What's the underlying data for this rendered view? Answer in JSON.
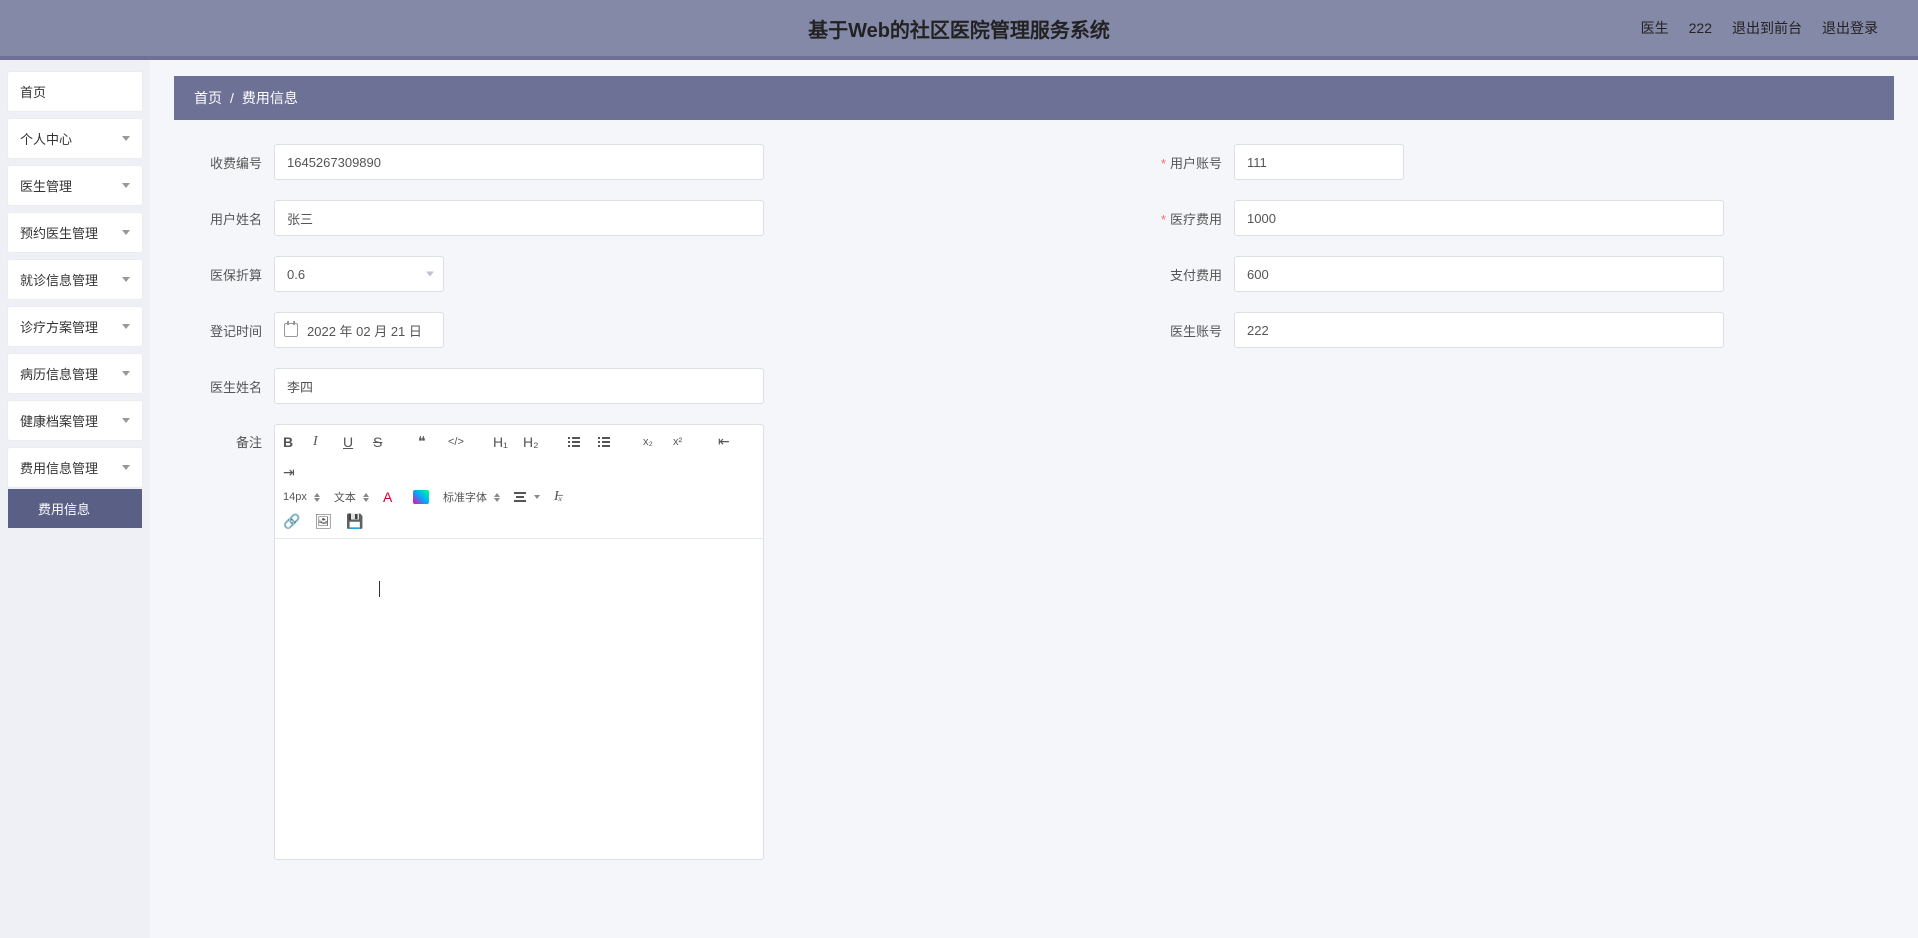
{
  "header": {
    "title": "基于Web的社区医院管理服务系统",
    "user_role_label": "医生",
    "user_name": "222",
    "logout_front": "退出到前台",
    "logout": "退出登录"
  },
  "sidebar": {
    "items": [
      {
        "label": "首页",
        "has_children": false
      },
      {
        "label": "个人中心",
        "has_children": true
      },
      {
        "label": "医生管理",
        "has_children": true
      },
      {
        "label": "预约医生管理",
        "has_children": true
      },
      {
        "label": "就诊信息管理",
        "has_children": true
      },
      {
        "label": "诊疗方案管理",
        "has_children": true
      },
      {
        "label": "病历信息管理",
        "has_children": true
      },
      {
        "label": "健康档案管理",
        "has_children": true
      },
      {
        "label": "费用信息管理",
        "has_children": true,
        "expanded": true,
        "children": [
          {
            "label": "费用信息"
          }
        ]
      }
    ]
  },
  "breadcrumb": {
    "home": "首页",
    "sep": "/",
    "current": "费用信息"
  },
  "form": {
    "fee_no": {
      "label": "收费编号",
      "value": "1645267309890"
    },
    "user_account": {
      "label": "用户账号",
      "value": "111",
      "required": true
    },
    "user_name": {
      "label": "用户姓名",
      "value": "张三"
    },
    "medical_fee": {
      "label": "医疗费用",
      "value": "1000",
      "required": true
    },
    "insurance_ratio": {
      "label": "医保折算",
      "value": "0.6"
    },
    "pay_fee": {
      "label": "支付费用",
      "value": "600"
    },
    "reg_time": {
      "label": "登记时间",
      "value": "2022 年 02 月 21 日"
    },
    "doctor_account": {
      "label": "医生账号",
      "value": "222"
    },
    "doctor_name": {
      "label": "医生姓名",
      "value": "李四"
    },
    "remark": {
      "label": "备注"
    }
  },
  "editor": {
    "font_size": "14px",
    "font_type": "文本",
    "font_family": "标准字体"
  }
}
